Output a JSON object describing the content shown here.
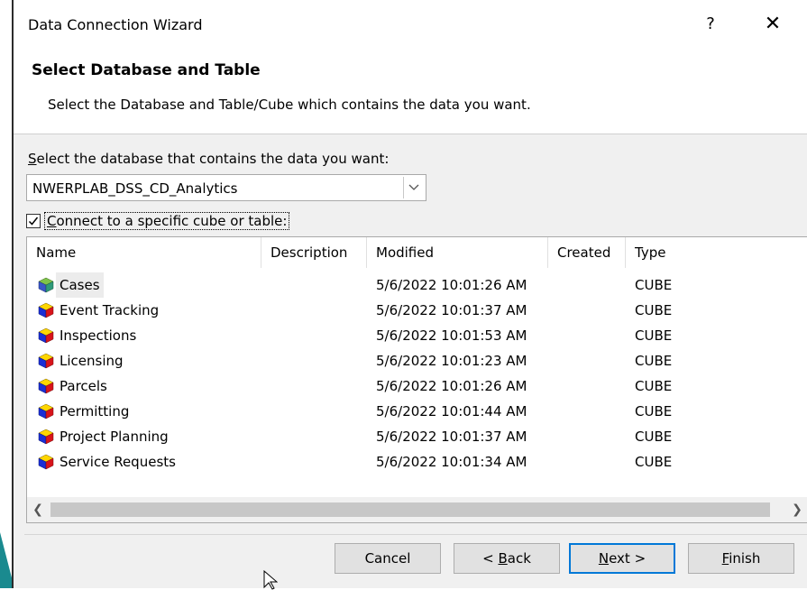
{
  "window": {
    "title": "Data Connection Wizard",
    "help_label": "?",
    "close_label": "✕"
  },
  "header": {
    "title": "Select Database and Table",
    "subtitle": "Select the Database and Table/Cube which contains the data you want."
  },
  "database": {
    "label": "Select the database that contains the data you want:",
    "selected": "NWERPLAB_DSS_CD_Analytics"
  },
  "connect_checkbox": {
    "label": "Connect to a specific cube or table:",
    "checked": true
  },
  "table": {
    "columns": [
      "Name",
      "Description",
      "Modified",
      "Created",
      "Type"
    ],
    "rows": [
      {
        "name": "Cases",
        "description": "",
        "modified": "5/6/2022 10:01:26 AM",
        "created": "",
        "type": "CUBE",
        "icon": "perspective-cube-icon"
      },
      {
        "name": "Event Tracking",
        "description": "",
        "modified": "5/6/2022 10:01:37 AM",
        "created": "",
        "type": "CUBE",
        "icon": "cube-icon"
      },
      {
        "name": "Inspections",
        "description": "",
        "modified": "5/6/2022 10:01:53 AM",
        "created": "",
        "type": "CUBE",
        "icon": "cube-icon"
      },
      {
        "name": "Licensing",
        "description": "",
        "modified": "5/6/2022 10:01:23 AM",
        "created": "",
        "type": "CUBE",
        "icon": "cube-icon"
      },
      {
        "name": "Parcels",
        "description": "",
        "modified": "5/6/2022 10:01:26 AM",
        "created": "",
        "type": "CUBE",
        "icon": "cube-icon"
      },
      {
        "name": "Permitting",
        "description": "",
        "modified": "5/6/2022 10:01:44 AM",
        "created": "",
        "type": "CUBE",
        "icon": "cube-icon"
      },
      {
        "name": "Project Planning",
        "description": "",
        "modified": "5/6/2022 10:01:37 AM",
        "created": "",
        "type": "CUBE",
        "icon": "cube-icon"
      },
      {
        "name": "Service Requests",
        "description": "",
        "modified": "5/6/2022 10:01:34 AM",
        "created": "",
        "type": "CUBE",
        "icon": "cube-icon"
      }
    ]
  },
  "buttons": {
    "cancel": "Cancel",
    "back": "< Back",
    "next": "Next >",
    "finish": "Finish"
  },
  "colors": {
    "accent": "#0078d7",
    "teal": "#1a8a8f",
    "button_face": "#e1e1e1",
    "panel": "#f0f0f0"
  }
}
